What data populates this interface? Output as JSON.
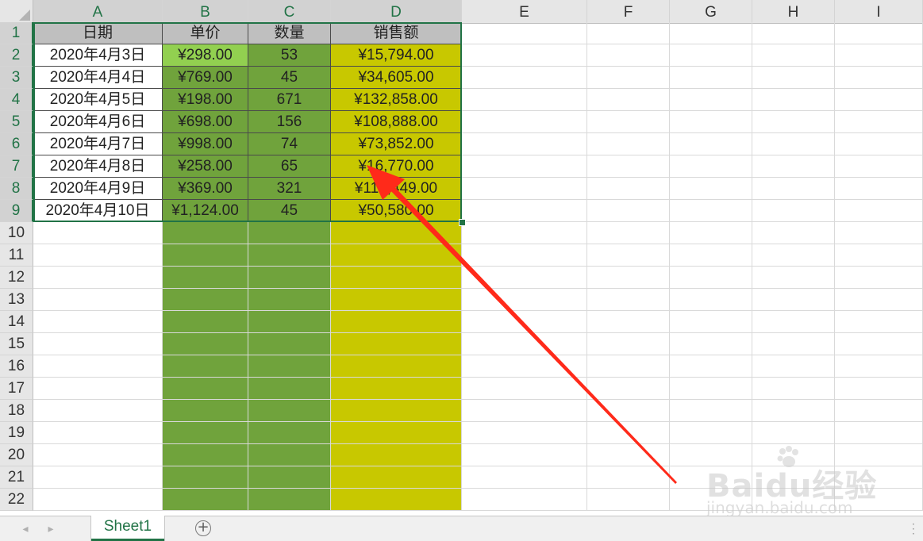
{
  "columns": [
    "A",
    "B",
    "C",
    "D",
    "E",
    "F",
    "G",
    "H",
    "I"
  ],
  "rows": [
    "1",
    "2",
    "3",
    "4",
    "5",
    "6",
    "7",
    "8",
    "9",
    "10",
    "11",
    "12",
    "13",
    "14",
    "15",
    "16",
    "17",
    "18",
    "19",
    "20",
    "21",
    "22"
  ],
  "table": {
    "headers": [
      "日期",
      "单价",
      "数量",
      "销售额"
    ],
    "data": [
      [
        "2020年4月3日",
        "¥298.00",
        "53",
        "¥15,794.00"
      ],
      [
        "2020年4月4日",
        "¥769.00",
        "45",
        "¥34,605.00"
      ],
      [
        "2020年4月5日",
        "¥198.00",
        "671",
        "¥132,858.00"
      ],
      [
        "2020年4月6日",
        "¥698.00",
        "156",
        "¥108,888.00"
      ],
      [
        "2020年4月7日",
        "¥998.00",
        "74",
        "¥73,852.00"
      ],
      [
        "2020年4月8日",
        "¥258.00",
        "65",
        "¥16,770.00"
      ],
      [
        "2020年4月9日",
        "¥369.00",
        "321",
        "¥118,449.00"
      ],
      [
        "2020年4月10日",
        "¥1,124.00",
        "45",
        "¥50,580.00"
      ]
    ]
  },
  "selection": {
    "range": "A1:D9"
  },
  "colors": {
    "header_fill": "#bfbfbf",
    "price_highlight": "#92d050",
    "green_fill": "#70a33c",
    "yellow_fill": "#c8c800",
    "arrow": "#ff2a1a",
    "excel_green": "#217346"
  },
  "sheet_tabs": {
    "active": "Sheet1",
    "add_icon": "plus-circle-icon"
  },
  "watermark": {
    "logo_text": "Baidu经验",
    "url_text": "jingyan.baidu.com"
  }
}
